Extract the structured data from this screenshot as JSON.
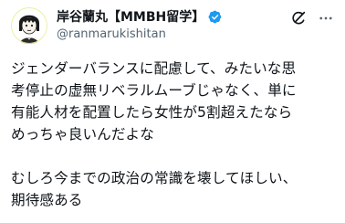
{
  "author": {
    "display_name": "岸谷蘭丸【MMBH留学】",
    "handle": "@ranmarukishitan",
    "verified": true,
    "avatar_icon": "avatar-illustration"
  },
  "actions": {
    "grok_icon": "grok-icon",
    "more_icon": "more-horizontal-icon"
  },
  "tweet": {
    "paragraph1": [
      "ジェンダーバランスに配慮して、みたいな思",
      "考停止の虚無リベラルムーブじゃなく、単に",
      "有能人材を配置したら女性が5割超えたなら",
      "めっちゃ良いんだよな"
    ],
    "paragraph2": [
      "むしろ今までの政治の常識を壊してほしい、",
      "期待感ある"
    ]
  },
  "colors": {
    "text": "#0f1419",
    "secondary": "#536471",
    "verified": "#1d9bf0",
    "background": "#ffffff"
  }
}
